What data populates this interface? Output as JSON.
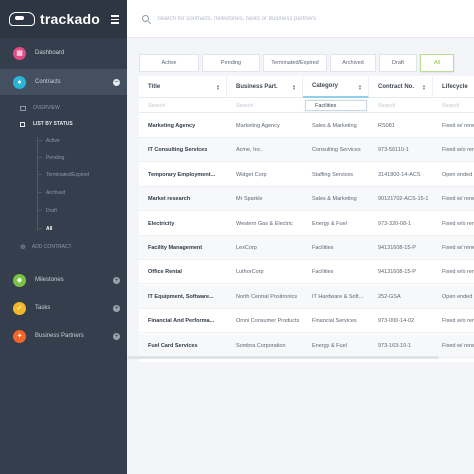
{
  "app": {
    "name": "trackado"
  },
  "search": {
    "placeholder": "Search for contracts, milestones, tasks or business partners"
  },
  "sidebar": {
    "items": [
      {
        "label": "Dashboard",
        "icon": "dashboard-icon",
        "color": "#e34b86"
      },
      {
        "label": "Contracts",
        "icon": "chat-bubble-icon",
        "color": "#29b6d6",
        "toggle": "−"
      },
      {
        "label": "Milestones",
        "icon": "milestone-icon",
        "color": "#7bc143",
        "toggle": "+"
      },
      {
        "label": "Tasks",
        "icon": "task-icon",
        "color": "#f3b72a",
        "toggle": "+"
      },
      {
        "label": "Business Partners",
        "icon": "partners-icon",
        "color": "#f0662b",
        "toggle": "+"
      }
    ],
    "contracts_menu": {
      "overview": "OVERVIEW",
      "list_by_status": "LIST BY STATUS",
      "statuses": [
        "Active",
        "Pending",
        "Terminated/Expired",
        "Archived",
        "Draft",
        "All"
      ],
      "add": "ADD CONTRACT"
    }
  },
  "tabs": [
    {
      "label": "Active"
    },
    {
      "label": "Pending"
    },
    {
      "label": "Terminated/Expired"
    },
    {
      "label": "Archived"
    },
    {
      "label": "Draft"
    },
    {
      "label": "All"
    }
  ],
  "table": {
    "columns": [
      "Title",
      "Business Part.",
      "Category",
      "Contract No.",
      "Lifecycle"
    ],
    "filters": [
      {
        "placeholder": "Search",
        "value": ""
      },
      {
        "placeholder": "Search",
        "value": ""
      },
      {
        "placeholder": "Search",
        "value": "Facilities"
      },
      {
        "placeholder": "Search",
        "value": ""
      },
      {
        "placeholder": "Search",
        "value": ""
      }
    ],
    "rows": [
      [
        "Marketing Agency",
        "Marketing Agency",
        "Sales & Marketing",
        "RS081",
        "Fixed w/ renew"
      ],
      [
        "IT Consulting Services",
        "Acme, Inc.",
        "Consulting Services",
        "973-56110-1",
        "Fixed w/o renew"
      ],
      [
        "Temporary Employment...",
        "Widget Corp",
        "Staffing Services",
        "3141800-14-ACS",
        "Open ended"
      ],
      [
        "Market research",
        "Mr Sparkle",
        "Sales & Marketing",
        "90121702-ACS-15-1",
        "Fixed w/ renew"
      ],
      [
        "Electricity",
        "Western Gas & Electric",
        "Energy & Fuel",
        "973-320-08-1",
        "Fixed w/o renew"
      ],
      [
        "Facility Management",
        "LexCorp",
        "Facilities",
        "94131608-15-P",
        "Fixed w/ renew"
      ],
      [
        "Office Rental",
        "LuthorCorp",
        "Facilities",
        "94131608-15-P",
        "Fixed w/o renew"
      ],
      [
        "IT Equipment, Software...",
        "North Central Positronics",
        "IT Hardware & Soft...",
        "252-GSA",
        "Open ended"
      ],
      [
        "Financial And Performa...",
        "Omni Consumer Products",
        "Financial Services",
        "973-000-14-02",
        "Fixed w/o renew"
      ],
      [
        "Fuel Card Services",
        "Sombra Corporation",
        "Energy & Fuel",
        "973-163-10-1",
        "Fixed w/ renew"
      ]
    ]
  }
}
